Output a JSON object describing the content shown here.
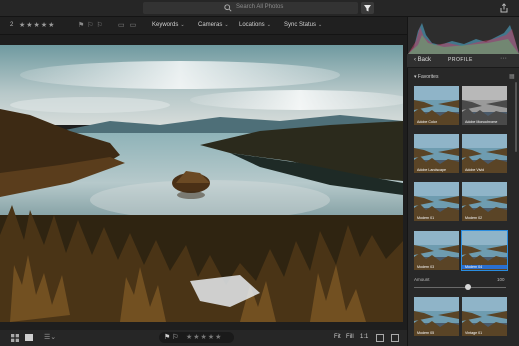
{
  "topbar": {
    "search_placeholder": "Search All Photos",
    "icons": [
      "search-icon",
      "filter-icon",
      "share-icon"
    ]
  },
  "filterbar": {
    "count": "2",
    "stars": "★★★★★",
    "flags": "⚑⚐⚐",
    "view_icons": "▭▭",
    "dropdowns": [
      {
        "label": "Keywords"
      },
      {
        "label": "Cameras"
      },
      {
        "label": "Locations"
      },
      {
        "label": "Sync Status"
      }
    ]
  },
  "panel": {
    "back_label": "Back",
    "title": "PROFILE",
    "favorites_label": "Favorites",
    "profiles": [
      {
        "label": "Adobe Color",
        "mono": false,
        "selected": false
      },
      {
        "label": "Adobe Monochrome",
        "mono": true,
        "selected": false
      },
      {
        "label": "Adobe Landscape",
        "mono": false,
        "selected": false
      },
      {
        "label": "Adobe Vivid",
        "mono": false,
        "selected": false
      },
      {
        "label": "Modern 01",
        "mono": false,
        "selected": false
      },
      {
        "label": "Modern 02",
        "mono": false,
        "selected": false
      },
      {
        "label": "Modern 03",
        "mono": false,
        "selected": false
      },
      {
        "label": "Modern 04",
        "mono": false,
        "selected": true
      },
      {
        "label": "Modern 05",
        "mono": false,
        "selected": false
      },
      {
        "label": "Vintage 01",
        "mono": false,
        "selected": false
      }
    ],
    "amount_label": "Amount",
    "amount_value": "100",
    "amount_fraction": 0.5
  },
  "bottombar": {
    "flags": "⚑⚐",
    "stars": "★★★★★",
    "fit": "Fit",
    "fill": "Fill",
    "one_to_one": "1:1"
  },
  "colors": {
    "accent": "#2a6fd0",
    "panel_bg": "#282828",
    "app_bg": "#1e1e1e"
  }
}
